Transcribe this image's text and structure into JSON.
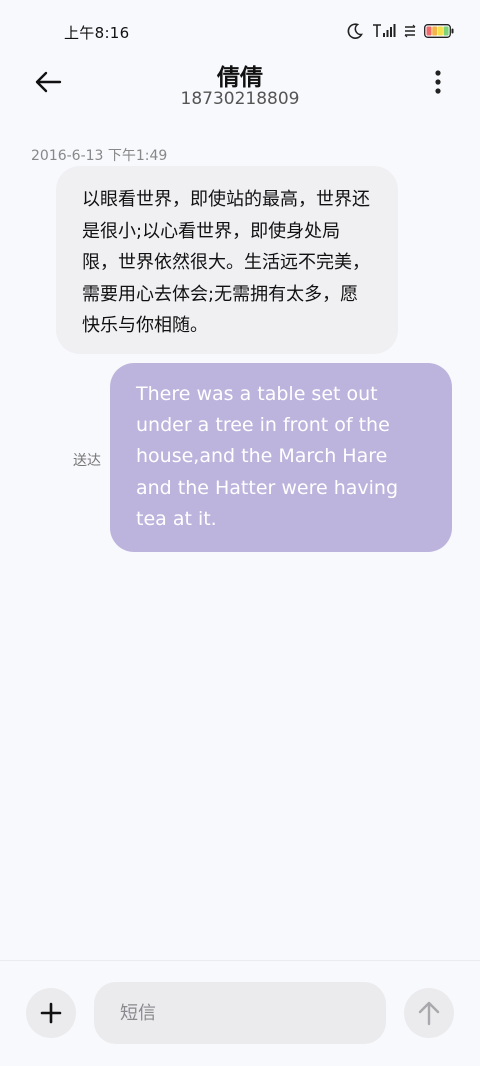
{
  "status_bar": {
    "time": "上午8:16",
    "icons": [
      "moon-icon",
      "signal-icon",
      "data-icon",
      "battery-icon"
    ]
  },
  "header": {
    "back_icon": "arrow-left-icon",
    "contact_name": "倩倩",
    "contact_number": "18730218809",
    "more_icon": "more-vertical-icon"
  },
  "conversation": {
    "timestamp": "2016-6-13 下午1:49",
    "messages": [
      {
        "direction": "incoming",
        "text": "以眼看世界，即使站的最高，世界还是很小;以心看世界，即使身处局限，世界依然很大。生活远不完美，需要用心去体会;无需拥有太多，愿快乐与你相随。"
      },
      {
        "direction": "outgoing",
        "status": "送达",
        "text": "There was a table set out under a tree in front of the house,and the March Hare and the Hatter were having tea at it."
      }
    ]
  },
  "compose": {
    "add_icon": "plus-icon",
    "placeholder": "短信",
    "value": "",
    "send_icon": "arrow-up-icon"
  },
  "colors": {
    "background": "#f8f9fd",
    "incoming_bubble": "#f0f0f3",
    "outgoing_bubble": "#bdb4dd",
    "control_bg": "#ebebee"
  }
}
